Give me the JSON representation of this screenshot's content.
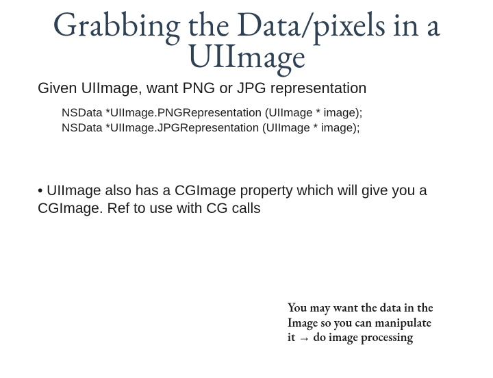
{
  "title": "Grabbing the Data/pixels in a UIImage",
  "subtitle": "Given UIImage, want PNG or JPG representation",
  "code_line1": "NSData *UIImage.PNGRepresentation (UIImage * image);",
  "code_line2": "NSData *UIImage.JPGRepresentation (UIImage * image);",
  "bullet": "• UIImage also has a CGImage property which will give you a CGImage. Ref to use with CG calls",
  "note_prefix": "You may want the data in the Image so you can manipulate it ",
  "note_arrow": "→",
  "note_suffix": " do image processing"
}
